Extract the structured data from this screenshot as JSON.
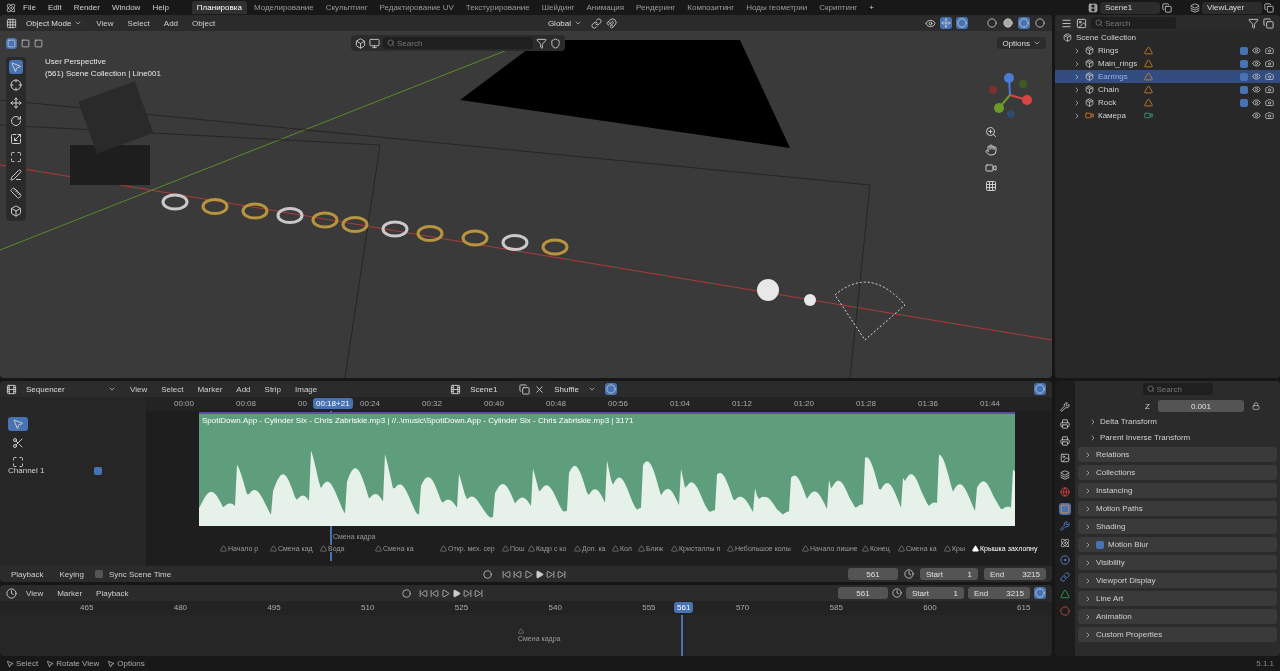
{
  "topbar": {
    "menus": [
      "File",
      "Edit",
      "Render",
      "Window",
      "Help"
    ],
    "workspaces": [
      {
        "label": "Планировка",
        "selected": true
      },
      {
        "label": "Моделирование",
        "selected": false
      },
      {
        "label": "Скульптинг",
        "selected": false
      },
      {
        "label": "Редактирование UV",
        "selected": false
      },
      {
        "label": "Текстурирование",
        "selected": false
      },
      {
        "label": "Шейдинг",
        "selected": false
      },
      {
        "label": "Анимация",
        "selected": false
      },
      {
        "label": "Рендеринг",
        "selected": false
      },
      {
        "label": "Композитинг",
        "selected": false
      },
      {
        "label": "Ноды геометрии",
        "selected": false
      },
      {
        "label": "Скриптинг",
        "selected": false
      }
    ],
    "add_tab": "+",
    "scene": "Scene1",
    "view_layer": "ViewLayer"
  },
  "viewport": {
    "mode": "Object Mode",
    "menus": [
      "View",
      "Select",
      "Add",
      "Object"
    ],
    "orientation": "Global",
    "search": {
      "placeholder": "Search"
    },
    "options": "Options",
    "info": [
      "User Perspective",
      "(561) Scene Collection | Line001"
    ],
    "shading_modes": [
      {
        "selected": false
      },
      {
        "selected": false
      },
      {
        "selected": true
      },
      {
        "selected": false
      }
    ],
    "tools": [
      {
        "selected": true
      },
      {
        "selected": false
      },
      {
        "selected": false
      },
      {
        "selected": false
      },
      {
        "selected": false
      },
      {
        "selected": false
      },
      {
        "selected": false
      },
      {
        "selected": false
      },
      {
        "selected": false
      }
    ]
  },
  "outliner": {
    "search": {
      "placeholder": "Search"
    },
    "root": "Scene Collection",
    "items": [
      {
        "name": "Rings",
        "kind": "collection",
        "selected": false,
        "checked": true
      },
      {
        "name": "Main_rings",
        "kind": "collection",
        "selected": false,
        "checked": true
      },
      {
        "name": "Earrings",
        "kind": "collection",
        "selected": true,
        "checked": true
      },
      {
        "name": "Chain",
        "kind": "collection",
        "selected": false,
        "checked": true
      },
      {
        "name": "Rock",
        "kind": "collection",
        "selected": false,
        "checked": true
      },
      {
        "name": "Камера",
        "kind": "camera",
        "selected": false
      }
    ]
  },
  "sequencer": {
    "editor": "Sequencer",
    "menus": [
      "View",
      "Select",
      "Marker",
      "Add",
      "Strip",
      "Image"
    ],
    "scene": "Scene1",
    "snapping": "Shuffle",
    "tools": [
      {
        "selected": true
      },
      {
        "selected": false
      },
      {
        "selected": false
      }
    ],
    "time_labels": [
      "00:00",
      "00:08",
      "00",
      "00:24",
      "00:32",
      "00:40",
      "00:48",
      "00:56",
      "01:04",
      "01:12",
      "01:20",
      "01:28",
      "01:36",
      "01:44"
    ],
    "playhead": "00:18+21",
    "channel": {
      "name": "Channel 1",
      "checked": true
    },
    "strip": {
      "label": "SpotiDown.App - Cylinder Six - Chris Zabriskie.mp3 | //..\\music\\SpotiDown.App - Cylinder Six - Chris Zabriskie.mp3 | 3171"
    },
    "current_marker": "Смена кадра",
    "markers": [
      {
        "label": "Начало р",
        "selected": false
      },
      {
        "label": "Смена кад",
        "selected": false
      },
      {
        "label": "Вода",
        "selected": false
      },
      {
        "label": "Смена ка",
        "selected": false
      },
      {
        "label": "Откр. мех. сер",
        "selected": false
      },
      {
        "label": "Пош",
        "selected": false
      },
      {
        "label": "Кадр с ко",
        "selected": false
      },
      {
        "label": "Доп. ка",
        "selected": false
      },
      {
        "label": "Кол",
        "selected": false
      },
      {
        "label": "Ближ",
        "selected": false
      },
      {
        "label": "Кристаллы п",
        "selected": false
      },
      {
        "label": "Небольшое колы",
        "selected": false
      },
      {
        "label": "Начало лишне",
        "selected": false
      },
      {
        "label": "Конец",
        "selected": false
      },
      {
        "label": "Смена ка",
        "selected": false
      },
      {
        "label": "Кры",
        "selected": false
      },
      {
        "label": "Крышка захлопну",
        "selected": true
      }
    ]
  },
  "playback_bar": {
    "menus": [
      "Playback",
      "Keying"
    ],
    "sync": {
      "label": "Sync Scene Time",
      "checked": false
    },
    "frame": "561",
    "start": {
      "label": "Start",
      "value": "1"
    },
    "end": {
      "label": "End",
      "value": "3215"
    }
  },
  "timeline": {
    "menus": [
      "View",
      "Marker",
      "Playback"
    ],
    "frame": "561",
    "start": {
      "label": "Start",
      "value": "1"
    },
    "end": {
      "label": "End",
      "value": "3215"
    },
    "ticks": [
      "465",
      "480",
      "495",
      "510",
      "525",
      "540",
      "555",
      "570",
      "585",
      "600",
      "615"
    ],
    "playhead": "561",
    "marker": "Смена кадра"
  },
  "properties": {
    "search": {
      "placeholder": "Search"
    },
    "transform": {
      "axis": "Z",
      "value": "0.001"
    },
    "subpanels": [
      "Delta Transform",
      "Parent Inverse Transform"
    ],
    "panels": [
      {
        "label": "Relations",
        "kind": "plain"
      },
      {
        "label": "Collections",
        "kind": "plain"
      },
      {
        "label": "Instancing",
        "kind": "plain"
      },
      {
        "label": "Motion Paths",
        "kind": "plain"
      },
      {
        "label": "Shading",
        "kind": "plain"
      },
      {
        "label": "Motion Blur",
        "kind": "checkbox",
        "checked": true
      },
      {
        "label": "Visibility",
        "kind": "plain"
      },
      {
        "label": "Viewport Display",
        "kind": "plain"
      },
      {
        "label": "Line Art",
        "kind": "plain"
      },
      {
        "label": "Animation",
        "kind": "plain"
      },
      {
        "label": "Custom Properties",
        "kind": "plain"
      }
    ],
    "tabs": [
      {
        "selected": false
      },
      {
        "selected": false
      },
      {
        "selected": false
      },
      {
        "selected": false
      },
      {
        "selected": false
      },
      {
        "selected": false
      },
      {
        "selected": true
      },
      {
        "selected": false
      },
      {
        "selected": false
      },
      {
        "selected": false
      },
      {
        "selected": false
      },
      {
        "selected": false
      },
      {
        "selected": false
      }
    ]
  },
  "status_bar": {
    "items": [
      "Select",
      "Rotate View",
      "Options"
    ],
    "version": "5.1.1"
  }
}
